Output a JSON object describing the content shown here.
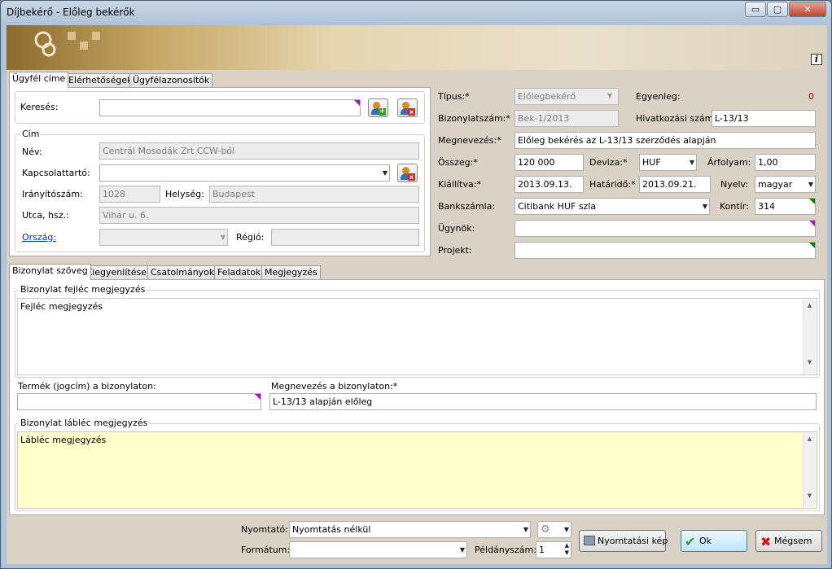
{
  "window": {
    "title": "Díjbekérő - Előleg bekérők",
    "btn_min": "▭",
    "btn_max": "▢",
    "btn_close": "✕"
  },
  "tabs_top": [
    "Ügyfél címe",
    "Elérhetőségek",
    "Ügyfélazonosítók"
  ],
  "client": {
    "search_label": "Keresés:",
    "address_group": "Cím",
    "name_label": "Név:",
    "name_value": "Centrál Mosodák Zrt CCW-ből",
    "contact_label": "Kapcsolattartó:",
    "zip_label": "Irányítószám:",
    "zip_value": "1028",
    "city_label": "Helység:",
    "city_value": "Budapest",
    "street_label": "Utca, hsz.:",
    "street_value": "Vihar u. 6.",
    "country_label": "Ország:",
    "region_label": "Régió:"
  },
  "doc": {
    "type_label": "Típus:*",
    "type_value": "Előlegbekérő",
    "balance_label": "Egyenleg:",
    "balance_value": "0",
    "docno_label": "Bizonylatszám:*",
    "docno_value": "Bek-1/2013",
    "ref_label": "Hivatkozási szám:",
    "ref_value": "L-13/13",
    "name_label": "Megnevezés:*",
    "name_value": "Előleg bekérés az L-13/13 szerződés alapján",
    "amount_label": "Összeg:*",
    "amount_value": "120 000",
    "currency_label": "Deviza:*",
    "currency_value": "HUF",
    "rate_label": "Árfolyam:",
    "rate_value": "1,00",
    "issued_label": "Kiállítva:*",
    "issued_value": "2013.09.13.",
    "due_label": "Határidő:*",
    "due_value": "2013.09.21.",
    "lang_label": "Nyelv:",
    "lang_value": "magyar",
    "bank_label": "Bankszámla:",
    "bank_value": "Citibank HUF szla",
    "kontir_label": "Kontír:",
    "kontir_value": "314",
    "agent_label": "Ügynök:",
    "project_label": "Projekt:"
  },
  "tabs_bottom": [
    "Bizonylat szöveg",
    "Kiegyenlítések",
    "Csatolmányok",
    "Feladatok",
    "Megjegyzés"
  ],
  "text": {
    "header_group": "Bizonylat fejléc megjegyzés",
    "header_value": "Fejléc megjegyzés",
    "product_label": "Termék (jogcím) a bizonylaton:",
    "docname_label": "Megnevezés a bizonylaton:*",
    "docname_value": "L-13/13 alapján előleg",
    "footer_group": "Bizonylat lábléc megjegyzés",
    "footer_value": "Lábléc megjegyzés"
  },
  "footer": {
    "printer_label": "Nyomtató:",
    "printer_value": "Nyomtatás nélkül",
    "format_label": "Formátum:",
    "copies_label": "Példányszám:",
    "copies_value": "1",
    "preview_btn": "Nyomtatási kép",
    "ok_btn": "Ok",
    "cancel_btn": "Mégsem"
  }
}
